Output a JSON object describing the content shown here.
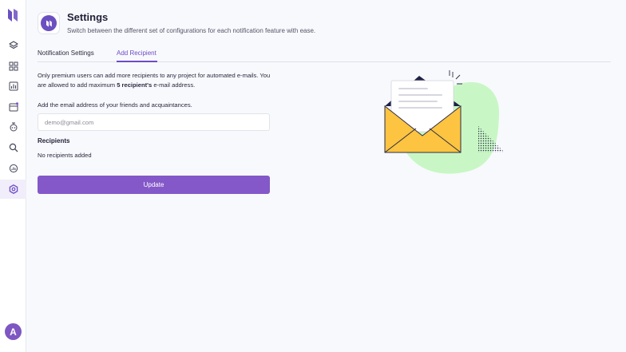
{
  "sidebar": {
    "logo": "brand-logo-icon",
    "items": [
      {
        "icon": "layers-icon"
      },
      {
        "icon": "grid-icon"
      },
      {
        "icon": "bar-chart-icon"
      },
      {
        "icon": "inbox-icon"
      },
      {
        "icon": "robot-icon"
      },
      {
        "icon": "search-icon"
      },
      {
        "icon": "analytics-icon"
      },
      {
        "icon": "settings-hex-icon",
        "active": true
      }
    ],
    "avatar_initial": "A"
  },
  "header": {
    "title": "Settings",
    "subtitle": "Switch between the different set of configurations for each notification feature with ease."
  },
  "tabs": [
    {
      "label": "Notification Settings",
      "active": false
    },
    {
      "label": "Add Recipient",
      "active": true
    }
  ],
  "content": {
    "info_prefix": "Only premium users can add more recipients to any project for automated e-mails. You are allowed to add maximum ",
    "info_bold": "5 recipient's",
    "info_suffix": " e-mail address.",
    "field_label": "Add the email address of your friends and acquaintances.",
    "email_placeholder": "demo@gmail.com",
    "email_value": "",
    "recipients_title": "Recipients",
    "recipients_empty": "No recipients added",
    "update_label": "Update"
  },
  "colors": {
    "accent": "#8458c9",
    "accent_text": "#6e4cc7",
    "background": "#f8f9fc",
    "envelope": "#fcc440",
    "blob": "#c8f7c5"
  }
}
